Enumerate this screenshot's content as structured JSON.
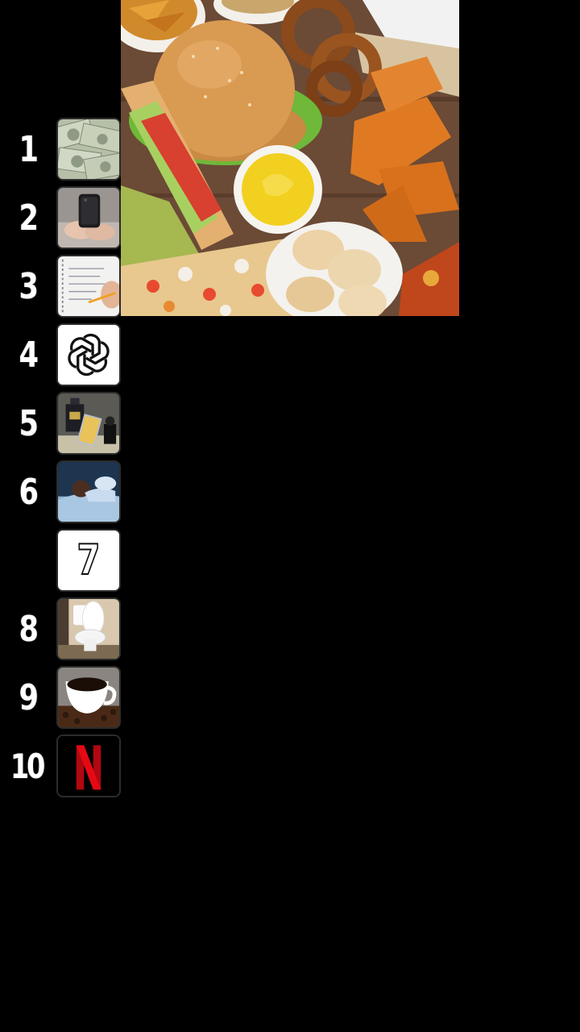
{
  "ranking": [
    {
      "rank": "1",
      "icon": "money-bills-icon"
    },
    {
      "rank": "2",
      "icon": "phone-in-hands-icon"
    },
    {
      "rank": "3",
      "icon": "notebook-writing-icon"
    },
    {
      "rank": "4",
      "icon": "chatgpt-logo-icon"
    },
    {
      "rank": "5",
      "icon": "perfume-bottles-icon"
    },
    {
      "rank": "6",
      "icon": "sleeping-person-icon"
    },
    {
      "rank": "",
      "icon": "number-seven-icon",
      "label": "7"
    },
    {
      "rank": "8",
      "icon": "toilet-icon"
    },
    {
      "rank": "9",
      "icon": "coffee-cup-icon"
    },
    {
      "rank": "10",
      "icon": "netflix-logo-icon"
    }
  ],
  "feature_image": {
    "icon": "fast-food-spread-icon"
  },
  "colors": {
    "background": "#000000",
    "netflix_red": "#e50914",
    "mustard": "#f2d020",
    "bun": "#d99a52"
  }
}
